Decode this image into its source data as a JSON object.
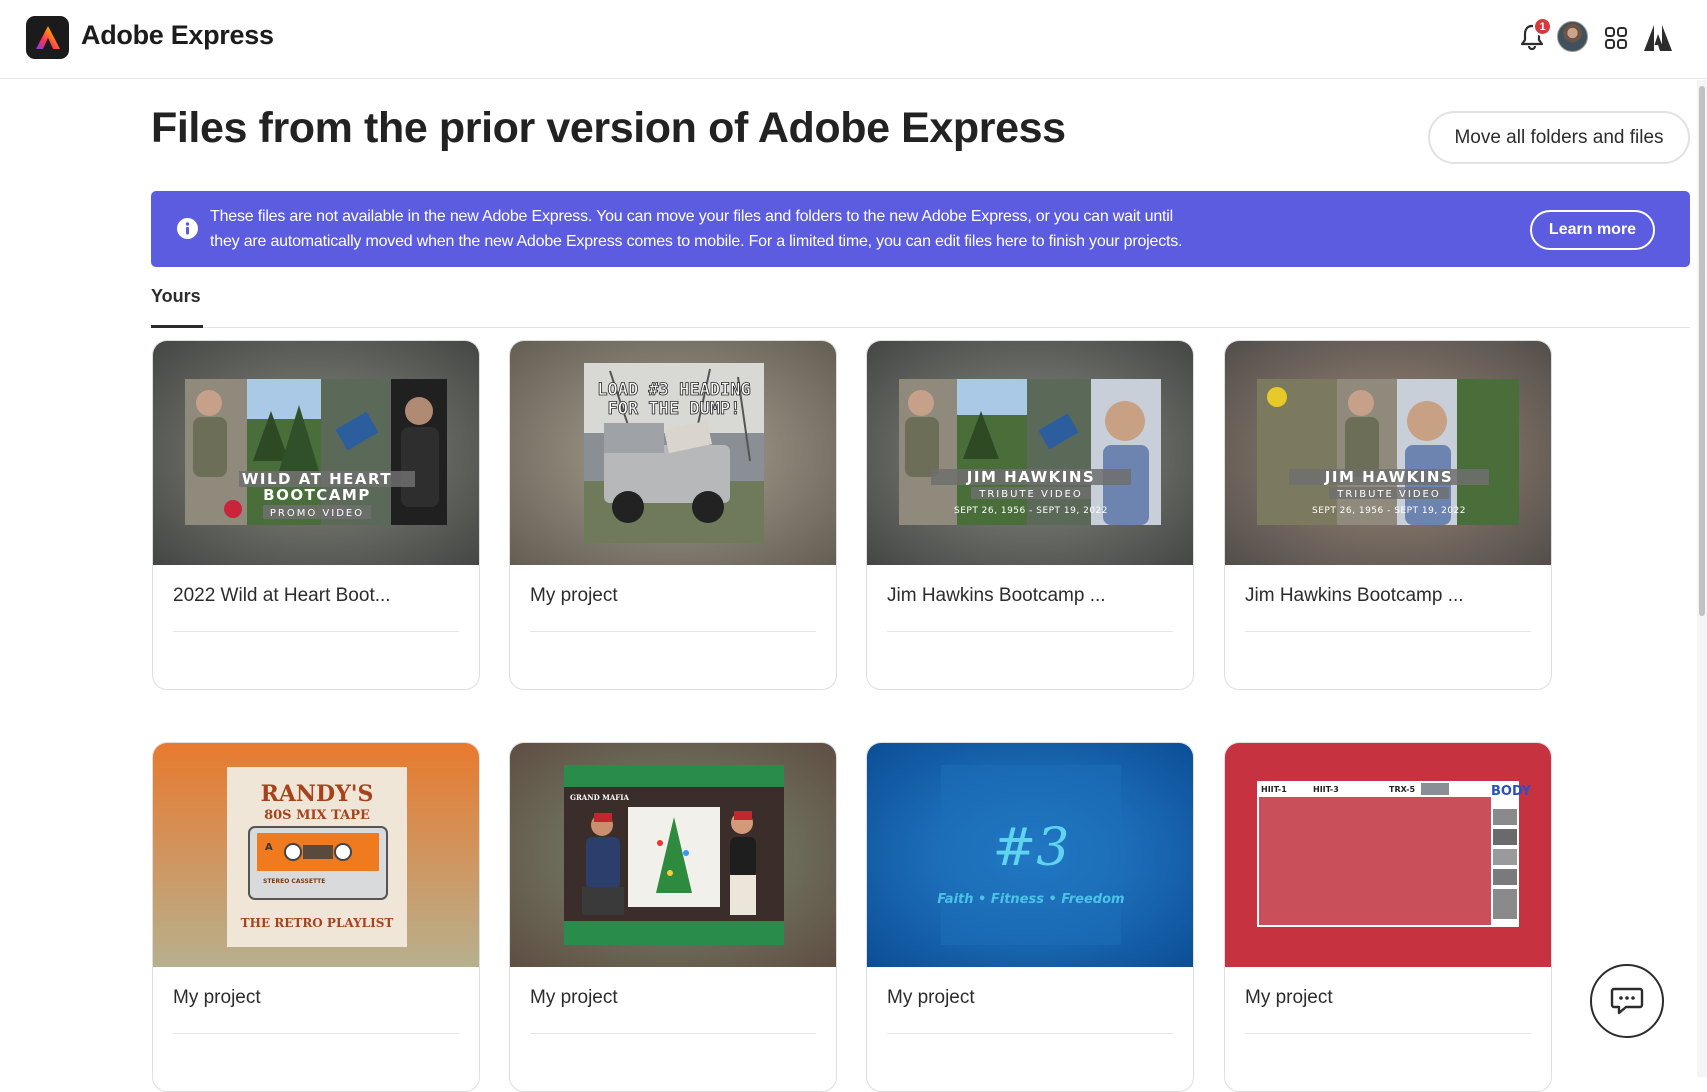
{
  "app": {
    "title": "Adobe Express"
  },
  "header": {
    "notification_count": "1"
  },
  "page": {
    "title": "Files from the prior version of Adobe Express",
    "move_button": "Move all folders and files"
  },
  "banner": {
    "line1": "These files are not available in the new Adobe Express. You can move your files and folders to the new Adobe Express, or you can wait until",
    "line2": "they are automatically moved when the new Adobe Express comes to mobile. For a limited time, you can edit files here to finish your projects.",
    "learn_more": "Learn more",
    "color": "#5c5ce0"
  },
  "tabs": [
    {
      "label": "Yours",
      "active": true
    }
  ],
  "cards": [
    {
      "name": "2022 Wild at Heart Boot...",
      "thumb": {
        "line1": "WILD AT HEART",
        "line2": "BOOTCAMP",
        "line3": "PROMO VIDEO"
      }
    },
    {
      "name": "My project",
      "thumb": {
        "line1": "LOAD #3 HEADING",
        "line2": "FOR THE DUMP!"
      }
    },
    {
      "name": "Jim Hawkins Bootcamp ...",
      "thumb": {
        "line1": "JIM HAWKINS",
        "line2": "TRIBUTE VIDEO",
        "line3": "SEPT 26, 1956 - SEPT 19, 2022"
      }
    },
    {
      "name": "Jim Hawkins Bootcamp ...",
      "thumb": {
        "line1": "JIM HAWKINS",
        "line2": "TRIBUTE VIDEO",
        "line3": "SEPT 26, 1956 - SEPT 19, 2022"
      }
    },
    {
      "name": "My project",
      "thumb": {
        "line1": "RANDY'S",
        "line2": "80S MIX TAPE",
        "line3": "THE RETRO PLAYLIST",
        "line4": "STEREO CASSETTE"
      }
    },
    {
      "name": "My project",
      "thumb": {
        "line1": "GRAND MAFIA"
      }
    },
    {
      "name": "My project",
      "thumb": {
        "line1": "#3",
        "line2": "Faith • Fitness • Freedom"
      }
    },
    {
      "name": "My project",
      "thumb": {
        "line1": "HIIT-1",
        "line2": "HIIT-3",
        "line3": "TRX-5",
        "line4": "BODY"
      }
    }
  ]
}
